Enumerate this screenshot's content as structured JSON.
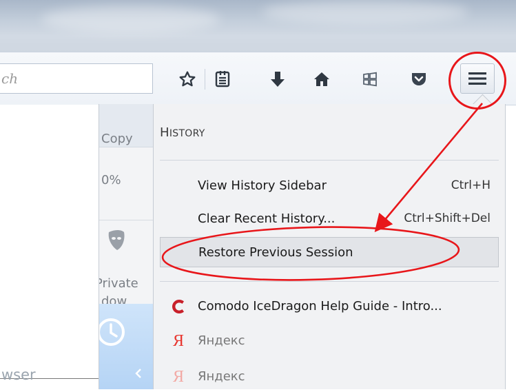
{
  "toolbar": {
    "search_placeholder": "ch"
  },
  "main_panel": {
    "copy_label": "Copy",
    "zoom_value": "0%",
    "private_window_line1": "Private",
    "private_window_line2": "dow",
    "browser_text": "wser"
  },
  "history_panel": {
    "title_first": "H",
    "title_rest": "ISTORY",
    "items": [
      {
        "label": "View History Sidebar",
        "shortcut": "Ctrl+H"
      },
      {
        "label": "Clear Recent History...",
        "shortcut": "Ctrl+Shift+Del"
      },
      {
        "label": "Restore Previous Session",
        "shortcut": ""
      }
    ],
    "recent": [
      {
        "label": "Comodo IceDragon Help Guide - Intro...",
        "icon": "comodo-c-icon"
      },
      {
        "label": "Яндекс",
        "icon": "yandex-icon"
      },
      {
        "label": "Яндекс",
        "icon": "yandex-icon"
      }
    ]
  },
  "colors": {
    "annotation_red": "#e8161a",
    "comodo_red": "#c8202a",
    "yandex_red": "#e8352e"
  }
}
